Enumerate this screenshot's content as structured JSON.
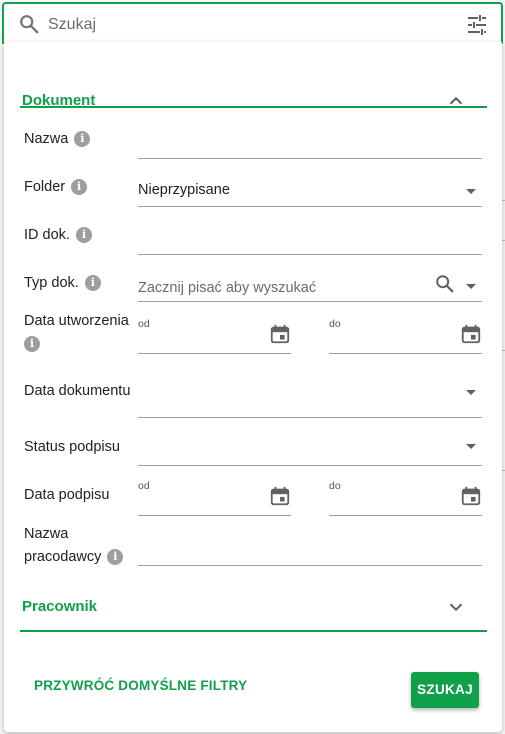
{
  "search": {
    "placeholder": "Szukaj"
  },
  "sections": {
    "dokument": {
      "title": "Dokument"
    },
    "pracownik": {
      "title": "Pracownik"
    }
  },
  "fields": {
    "nazwa": {
      "label": "Nazwa"
    },
    "folder": {
      "label": "Folder",
      "value": "Nieprzypisane"
    },
    "id_dok": {
      "label": "ID dok."
    },
    "typ_dok": {
      "label": "Typ dok.",
      "placeholder": "Zacznij pisać aby wyszukać"
    },
    "data_utworzenia": {
      "label": "Data utworzenia",
      "from_label": "od",
      "to_label": "do"
    },
    "data_dokumentu": {
      "label": "Data dokumentu"
    },
    "status_podpisu": {
      "label": "Status podpisu"
    },
    "data_podpisu": {
      "label": "Data podpisu",
      "from_label": "od",
      "to_label": "do"
    },
    "nazwa_pracodawcy": {
      "label_line1": "Nazwa",
      "label_line2": "pracodawcy"
    }
  },
  "actions": {
    "reset_label": "PRZYWRÓĆ DOMYŚLNE FILTRY",
    "search_label": "SZUKAJ"
  },
  "colors": {
    "accent": "#10a04a",
    "info_icon": "#9e9e9e"
  },
  "icons": [
    "search-icon",
    "tune-icon",
    "chevron-up-icon",
    "chevron-down-icon",
    "info-icon",
    "calendar-icon",
    "dropdown-arrow-icon"
  ]
}
